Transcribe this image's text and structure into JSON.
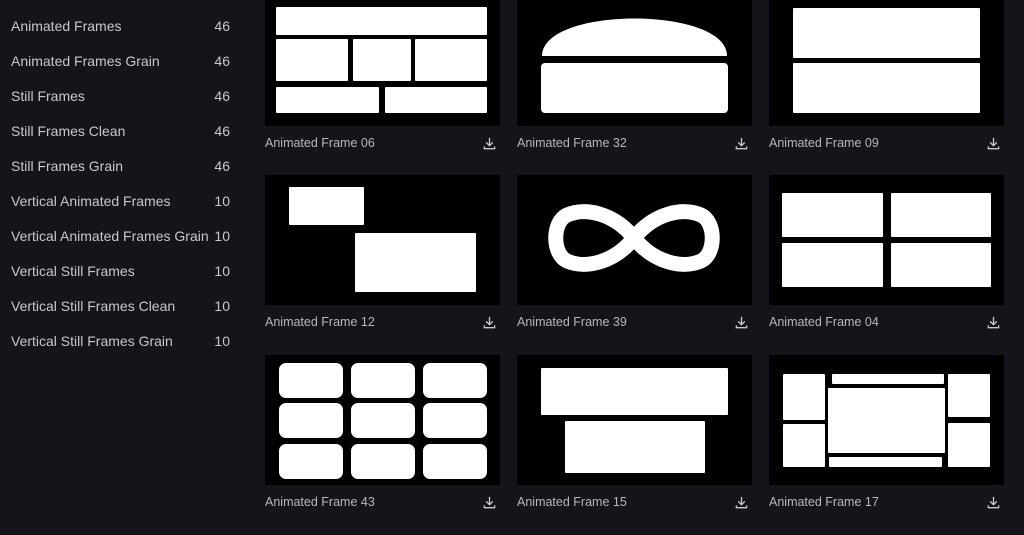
{
  "sidebar": {
    "items": [
      {
        "label": "Animated Frames",
        "count": "46"
      },
      {
        "label": "Animated Frames Grain",
        "count": "46"
      },
      {
        "label": "Still Frames",
        "count": "46"
      },
      {
        "label": "Still Frames Clean",
        "count": "46"
      },
      {
        "label": "Still Frames Grain",
        "count": "46"
      },
      {
        "label": "Vertical Animated Frames",
        "count": "10"
      },
      {
        "label": "Vertical Animated Frames Grain",
        "count": "10"
      },
      {
        "label": "Vertical Still Frames",
        "count": "10"
      },
      {
        "label": "Vertical Still Frames Clean",
        "count": "10"
      },
      {
        "label": "Vertical Still Frames Grain",
        "count": "10"
      }
    ]
  },
  "cards": [
    {
      "title": "Animated Frame 06"
    },
    {
      "title": "Animated Frame 32"
    },
    {
      "title": "Animated Frame 09"
    },
    {
      "title": "Animated Frame 12"
    },
    {
      "title": "Animated Frame 39"
    },
    {
      "title": "Animated Frame 04"
    },
    {
      "title": "Animated Frame 43"
    },
    {
      "title": "Animated Frame 15"
    },
    {
      "title": "Animated Frame 17"
    }
  ],
  "colors": {
    "background": "#15141a",
    "thumbnail": "#000000",
    "text": "#c8c7cc"
  },
  "icons": {
    "download": "download-icon"
  }
}
